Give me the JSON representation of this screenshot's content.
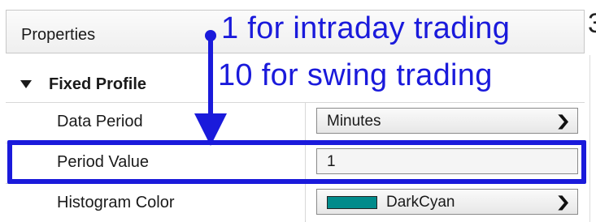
{
  "properties_panel": {
    "header_label": "Properties",
    "top_right_glyph": "3",
    "category": {
      "label": "Fixed Profile",
      "expanded": true
    },
    "rows": [
      {
        "name": "Data Period",
        "type": "dropdown",
        "value": "Minutes"
      },
      {
        "name": "Period Value",
        "type": "text",
        "value": "1"
      },
      {
        "name": "Histogram Color",
        "type": "color-dropdown",
        "value": "DarkCyan",
        "swatch_color": "#008B8B"
      }
    ]
  },
  "annotations": {
    "line1": "1 for intraday trading",
    "line2": "10 for swing trading",
    "color": "#1a1adb"
  }
}
